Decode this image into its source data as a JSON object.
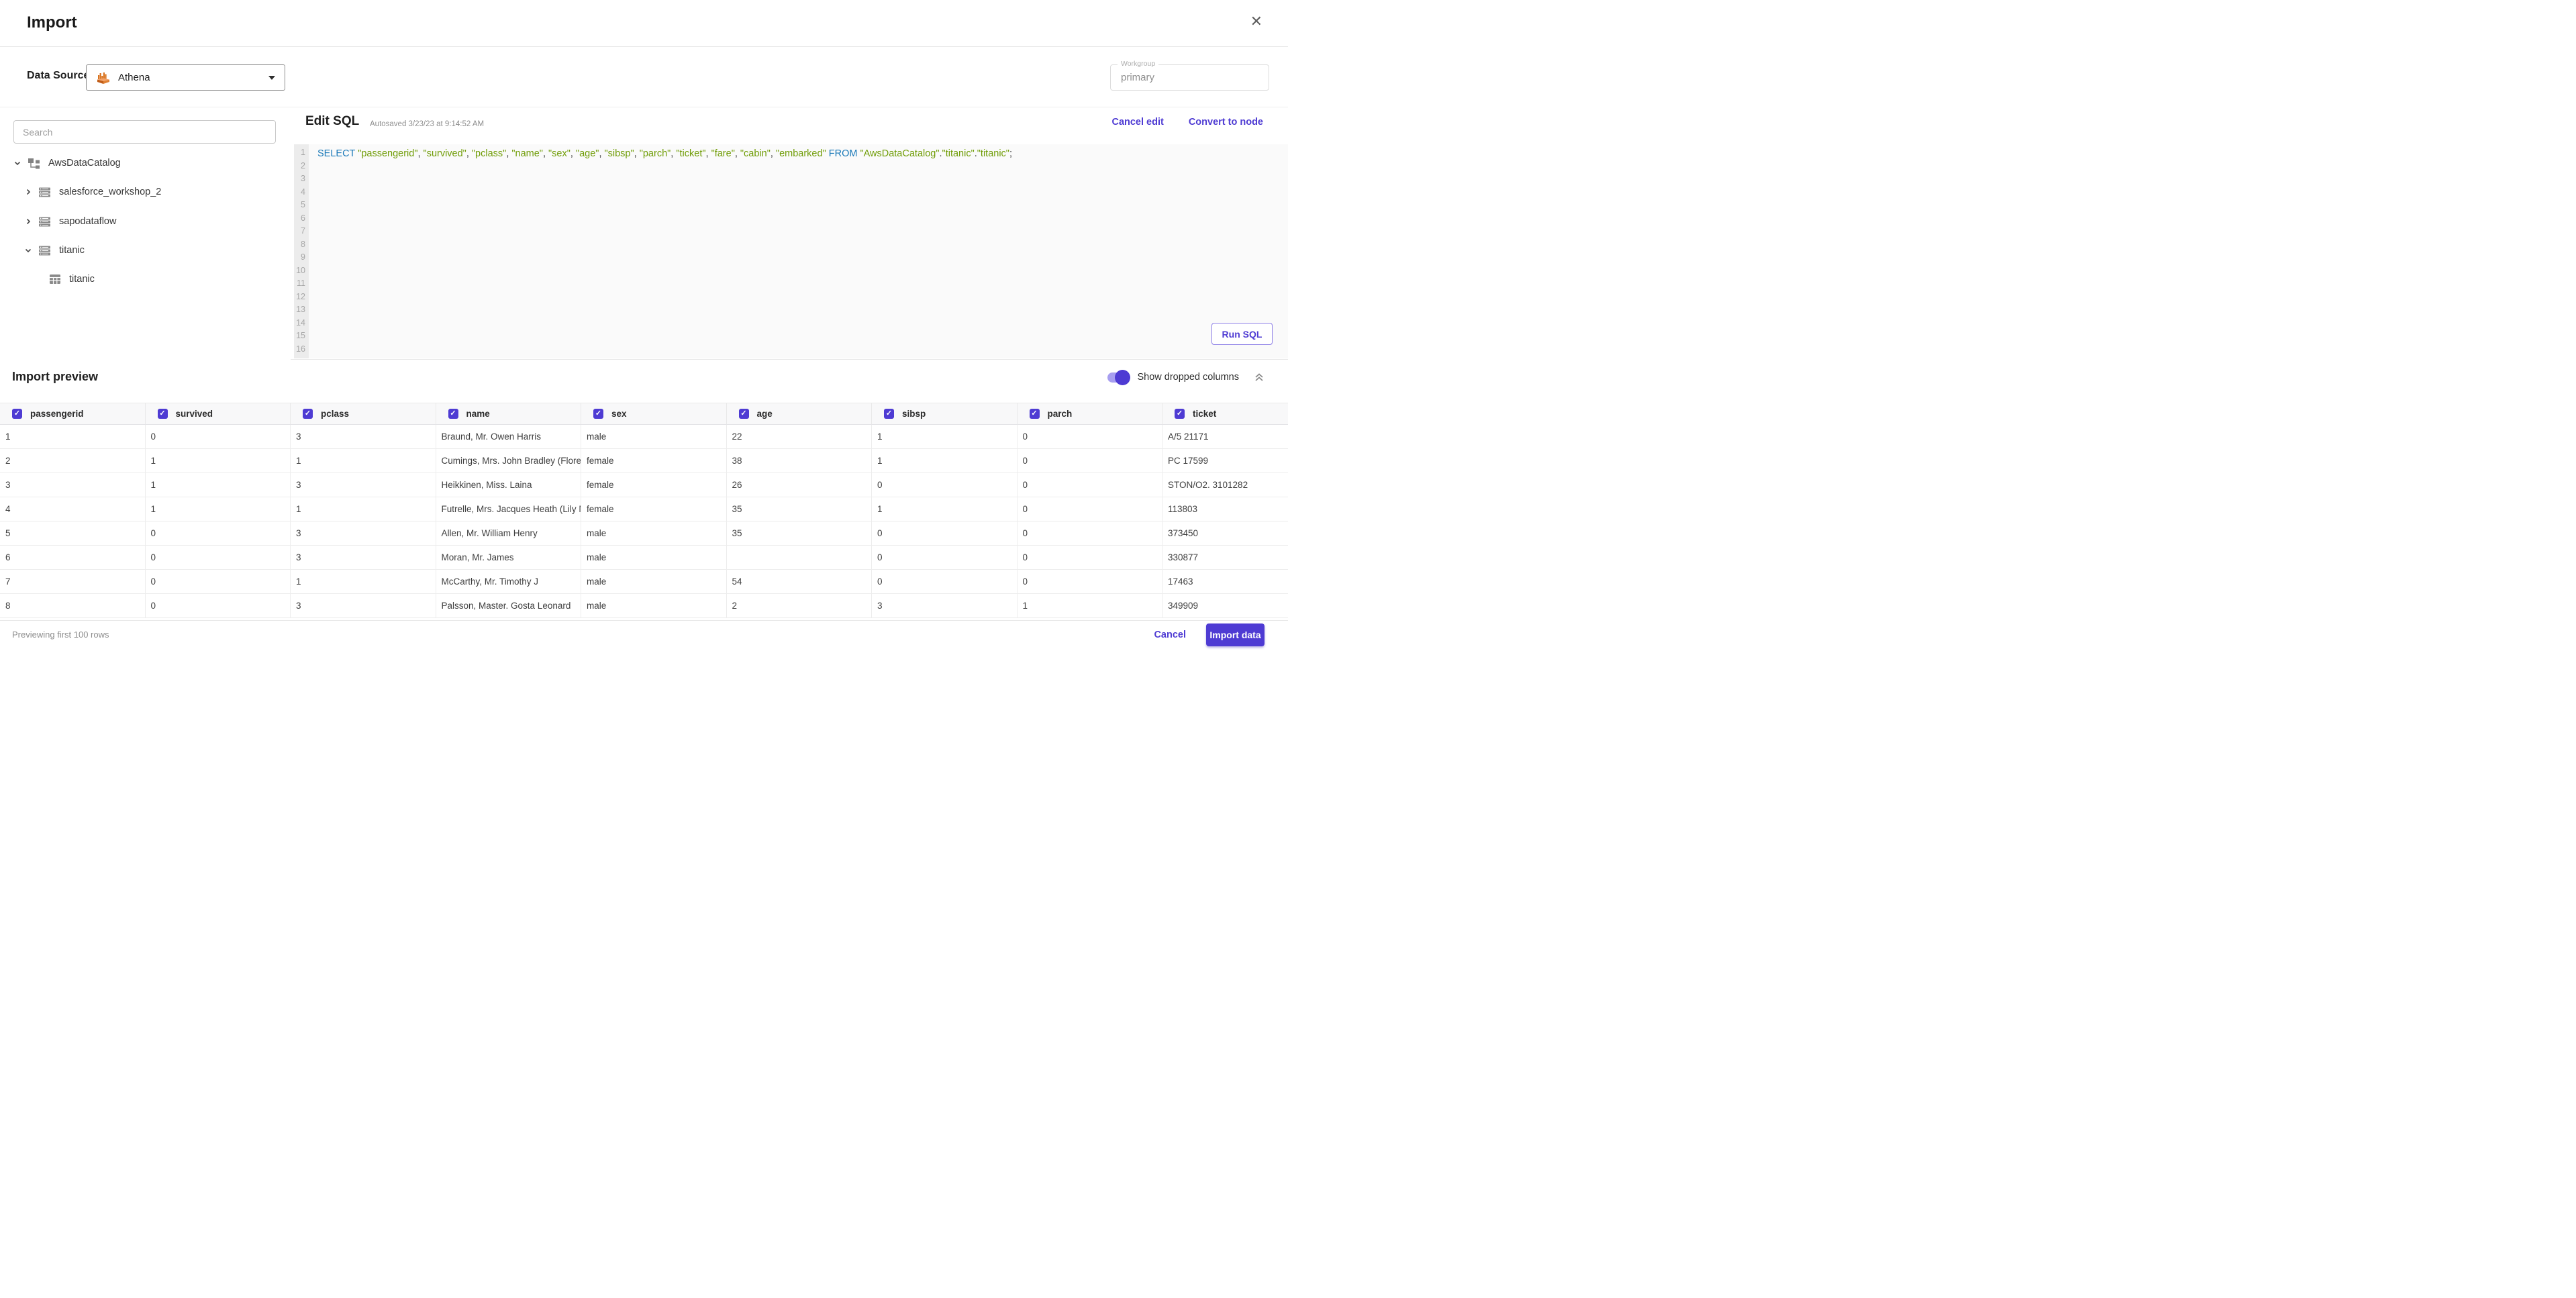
{
  "header": {
    "title": "Import",
    "close_icon": "✕"
  },
  "datasource": {
    "label": "Data Source:",
    "selected": "Athena",
    "workgroup_label": "Workgroup",
    "workgroup_value": "primary"
  },
  "sidebar": {
    "search_placeholder": "Search",
    "tree": [
      {
        "label": "AwsDataCatalog",
        "level": 0,
        "expanded": true,
        "icon": "catalog-icon"
      },
      {
        "label": "salesforce_workshop_2",
        "level": 1,
        "expanded": false,
        "icon": "database-icon"
      },
      {
        "label": "sapodataflow",
        "level": 1,
        "expanded": false,
        "icon": "database-icon"
      },
      {
        "label": "titanic",
        "level": 1,
        "expanded": true,
        "icon": "database-icon"
      },
      {
        "label": "titanic",
        "level": 2,
        "icon": "table-icon"
      }
    ]
  },
  "editor": {
    "title": "Edit SQL",
    "autosaved": "Autosaved 3/23/23 at 9:14:52 AM",
    "cancel_edit": "Cancel edit",
    "convert_to_node": "Convert to node",
    "run_sql": "Run SQL",
    "line_count": 16,
    "sql_tokens": [
      {
        "type": "keyword",
        "text": "SELECT "
      },
      {
        "type": "string",
        "text": "\"passengerid\""
      },
      {
        "type": "punct",
        "text": ", "
      },
      {
        "type": "string",
        "text": "\"survived\""
      },
      {
        "type": "punct",
        "text": ", "
      },
      {
        "type": "string",
        "text": "\"pclass\""
      },
      {
        "type": "punct",
        "text": ", "
      },
      {
        "type": "string",
        "text": "\"name\""
      },
      {
        "type": "punct",
        "text": ", "
      },
      {
        "type": "string",
        "text": "\"sex\""
      },
      {
        "type": "punct",
        "text": ", "
      },
      {
        "type": "string",
        "text": "\"age\""
      },
      {
        "type": "punct",
        "text": ", "
      },
      {
        "type": "string",
        "text": "\"sibsp\""
      },
      {
        "type": "punct",
        "text": ", "
      },
      {
        "type": "string",
        "text": "\"parch\""
      },
      {
        "type": "punct",
        "text": ", "
      },
      {
        "type": "string",
        "text": "\"ticket\""
      },
      {
        "type": "punct",
        "text": ", "
      },
      {
        "type": "string",
        "text": "\"fare\""
      },
      {
        "type": "punct",
        "text": ", "
      },
      {
        "type": "string",
        "text": "\"cabin\""
      },
      {
        "type": "punct",
        "text": ", "
      },
      {
        "type": "string",
        "text": "\"embarked\""
      },
      {
        "type": "punct",
        "text": " "
      },
      {
        "type": "keyword",
        "text": "FROM "
      },
      {
        "type": "string",
        "text": "\"AwsDataCatalog\""
      },
      {
        "type": "punct",
        "text": "."
      },
      {
        "type": "string",
        "text": "\"titanic\""
      },
      {
        "type": "punct",
        "text": "."
      },
      {
        "type": "string",
        "text": "\"titanic\""
      },
      {
        "type": "punct",
        "text": ";"
      }
    ]
  },
  "preview": {
    "title": "Import preview",
    "toggle_label": "Show dropped columns",
    "toggle_on": true,
    "table": {
      "columns": [
        "passengerid",
        "survived",
        "pclass",
        "name",
        "sex",
        "age",
        "sibsp",
        "parch",
        "ticket"
      ],
      "rows": [
        [
          "1",
          "0",
          "3",
          "Braund, Mr. Owen Harris",
          "male",
          "22",
          "1",
          "0",
          "A/5 21171"
        ],
        [
          "2",
          "1",
          "1",
          "Cumings, Mrs. John Bradley (Florence Briggs Thayer)",
          "female",
          "38",
          "1",
          "0",
          "PC 17599"
        ],
        [
          "3",
          "1",
          "3",
          "Heikkinen, Miss. Laina",
          "female",
          "26",
          "0",
          "0",
          "STON/O2. 3101282"
        ],
        [
          "4",
          "1",
          "1",
          "Futrelle, Mrs. Jacques Heath (Lily May Peel)",
          "female",
          "35",
          "1",
          "0",
          "113803"
        ],
        [
          "5",
          "0",
          "3",
          "Allen, Mr. William Henry",
          "male",
          "35",
          "0",
          "0",
          "373450"
        ],
        [
          "6",
          "0",
          "3",
          "Moran, Mr. James",
          "male",
          "",
          "0",
          "0",
          "330877"
        ],
        [
          "7",
          "0",
          "1",
          "McCarthy, Mr. Timothy J",
          "male",
          "54",
          "0",
          "0",
          "17463"
        ],
        [
          "8",
          "0",
          "3",
          "Palsson, Master. Gosta Leonard",
          "male",
          "2",
          "3",
          "1",
          "349909"
        ]
      ]
    }
  },
  "footer": {
    "status": "Previewing first 100 rows",
    "cancel": "Cancel",
    "import": "Import data"
  },
  "colors": {
    "accent": "#4e3bd3",
    "keyword_blue": "#1878b8",
    "string_green": "#6f9c05",
    "athena_orange": "#d9731f"
  }
}
